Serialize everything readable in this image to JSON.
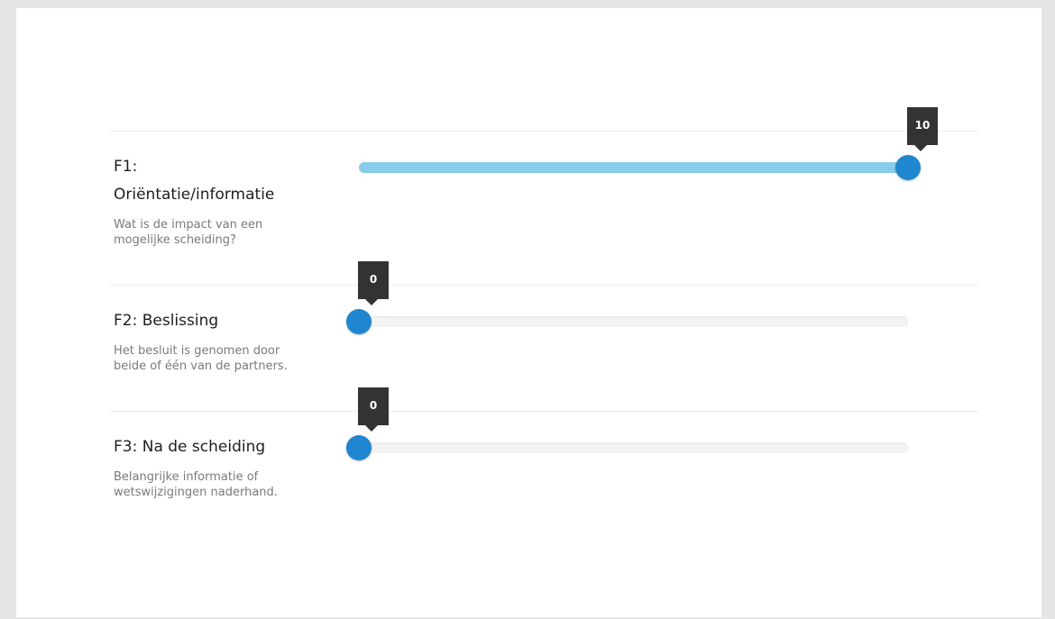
{
  "colors": {
    "fill": "#89cbea",
    "handle": "#1f86cf",
    "tooltip_bg": "#333333"
  },
  "sliders": [
    {
      "title": "F1:\nOriëntatie/informatie",
      "description": "Wat is de impact van een mogelijke scheiding?",
      "value": 10,
      "max": 10
    },
    {
      "title": "F2: Beslissing",
      "description": "Het besluit is genomen door beide of één van de partners.",
      "value": 0,
      "max": 10
    },
    {
      "title": "F3: Na de scheiding",
      "description": "Belangrijke informatie of wetswijzigingen naderhand.",
      "value": 0,
      "max": 10
    }
  ]
}
